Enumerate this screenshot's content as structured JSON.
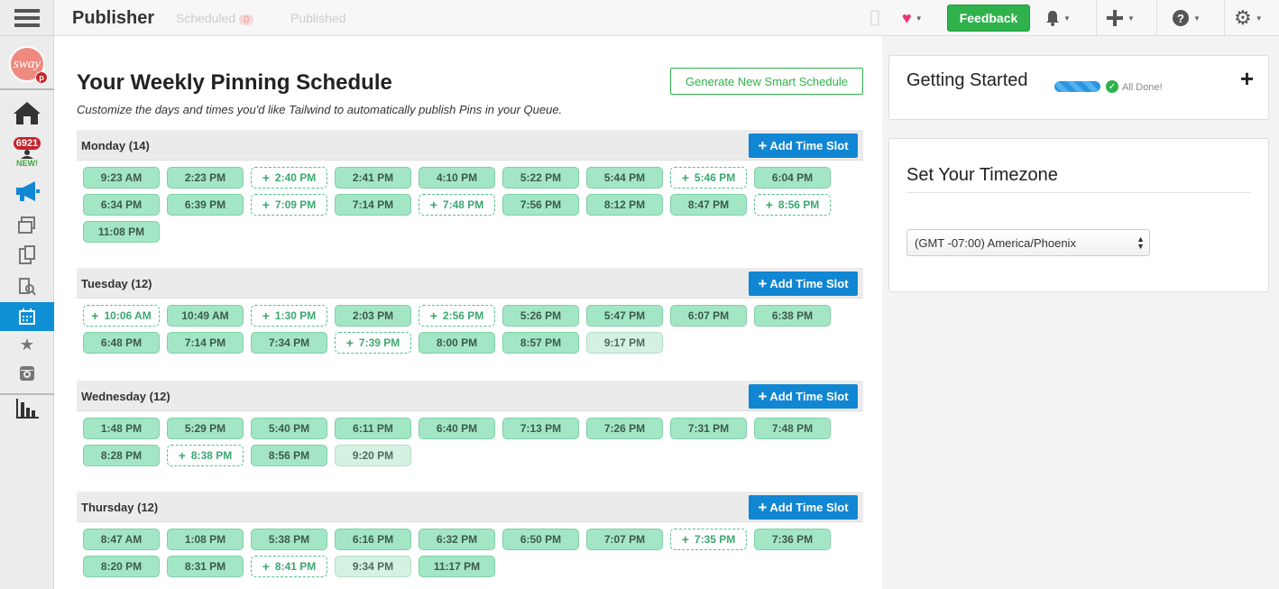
{
  "app": {
    "title": "Publisher",
    "ghost_tabs": [
      {
        "label": "Scheduled",
        "count": "0"
      },
      {
        "label": "Published"
      }
    ],
    "feedback_label": "Feedback"
  },
  "sidebar": {
    "avatar_text": "sway",
    "avatar_pin": "p",
    "badge_count": "6921",
    "new_label": "NEW!"
  },
  "main": {
    "title": "Your Weekly Pinning Schedule",
    "subtitle": "Customize the days and times you'd like Tailwind to automatically publish Pins in your Queue.",
    "generate_button": "Generate New Smart Schedule",
    "add_slot_label": "Add Time Slot",
    "days": [
      {
        "name": "Monday (14)",
        "slots": [
          {
            "time": "9:23 AM",
            "state": "filled"
          },
          {
            "time": "2:23 PM",
            "state": "filled"
          },
          {
            "time": "2:40 PM",
            "state": "empty"
          },
          {
            "time": "2:41 PM",
            "state": "filled"
          },
          {
            "time": "4:10 PM",
            "state": "filled"
          },
          {
            "time": "5:22 PM",
            "state": "filled"
          },
          {
            "time": "5:44 PM",
            "state": "filled"
          },
          {
            "time": "5:46 PM",
            "state": "empty"
          },
          {
            "time": "6:04 PM",
            "state": "filled"
          },
          {
            "time": "6:34 PM",
            "state": "filled"
          },
          {
            "time": "6:39 PM",
            "state": "filled"
          },
          {
            "time": "7:09 PM",
            "state": "empty"
          },
          {
            "time": "7:14 PM",
            "state": "filled"
          },
          {
            "time": "7:48 PM",
            "state": "empty"
          },
          {
            "time": "7:56 PM",
            "state": "filled"
          },
          {
            "time": "8:12 PM",
            "state": "filled"
          },
          {
            "time": "8:47 PM",
            "state": "filled"
          },
          {
            "time": "8:56 PM",
            "state": "empty"
          },
          {
            "time": "11:08 PM",
            "state": "filled"
          }
        ]
      },
      {
        "name": "Tuesday (12)",
        "slots": [
          {
            "time": "10:06 AM",
            "state": "empty"
          },
          {
            "time": "10:49 AM",
            "state": "filled"
          },
          {
            "time": "1:30 PM",
            "state": "empty"
          },
          {
            "time": "2:03 PM",
            "state": "filled"
          },
          {
            "time": "2:56 PM",
            "state": "empty"
          },
          {
            "time": "5:26 PM",
            "state": "filled"
          },
          {
            "time": "5:47 PM",
            "state": "filled"
          },
          {
            "time": "6:07 PM",
            "state": "filled"
          },
          {
            "time": "6:38 PM",
            "state": "filled"
          },
          {
            "time": "6:48 PM",
            "state": "filled"
          },
          {
            "time": "7:14 PM",
            "state": "filled"
          },
          {
            "time": "7:34 PM",
            "state": "filled"
          },
          {
            "time": "7:39 PM",
            "state": "empty"
          },
          {
            "time": "8:00 PM",
            "state": "filled"
          },
          {
            "time": "8:57 PM",
            "state": "filled"
          },
          {
            "time": "9:17 PM",
            "state": "pending"
          }
        ]
      },
      {
        "name": "Wednesday (12)",
        "slots": [
          {
            "time": "1:48 PM",
            "state": "filled"
          },
          {
            "time": "5:29 PM",
            "state": "filled"
          },
          {
            "time": "5:40 PM",
            "state": "filled"
          },
          {
            "time": "6:11 PM",
            "state": "filled"
          },
          {
            "time": "6:40 PM",
            "state": "filled"
          },
          {
            "time": "7:13 PM",
            "state": "filled"
          },
          {
            "time": "7:26 PM",
            "state": "filled"
          },
          {
            "time": "7:31 PM",
            "state": "filled"
          },
          {
            "time": "7:48 PM",
            "state": "filled"
          },
          {
            "time": "8:28 PM",
            "state": "filled"
          },
          {
            "time": "8:38 PM",
            "state": "empty"
          },
          {
            "time": "8:56 PM",
            "state": "filled"
          },
          {
            "time": "9:20 PM",
            "state": "pending"
          }
        ]
      },
      {
        "name": "Thursday (12)",
        "slots": [
          {
            "time": "8:47 AM",
            "state": "filled"
          },
          {
            "time": "1:08 PM",
            "state": "filled"
          },
          {
            "time": "5:38 PM",
            "state": "filled"
          },
          {
            "time": "6:16 PM",
            "state": "filled"
          },
          {
            "time": "6:32 PM",
            "state": "filled"
          },
          {
            "time": "6:50 PM",
            "state": "filled"
          },
          {
            "time": "7:07 PM",
            "state": "filled"
          },
          {
            "time": "7:35 PM",
            "state": "empty"
          },
          {
            "time": "7:36 PM",
            "state": "filled"
          },
          {
            "time": "8:20 PM",
            "state": "filled"
          },
          {
            "time": "8:31 PM",
            "state": "filled"
          },
          {
            "time": "8:41 PM",
            "state": "empty"
          },
          {
            "time": "9:34 PM",
            "state": "pending"
          },
          {
            "time": "11:17 PM",
            "state": "filled"
          }
        ]
      }
    ]
  },
  "getting_started": {
    "title": "Getting Started",
    "status": "All Done!",
    "progress": 1.0
  },
  "timezone": {
    "title": "Set Your Timezone",
    "selected": "(GMT -07:00) America/Phoenix"
  },
  "colors": {
    "accent_blue": "#1186d2",
    "feedback_green": "#2fb24c",
    "slot_filled": "#a3e6c5",
    "slot_empty_border": "#4fc089"
  },
  "icons": [
    "hamburger-icon",
    "home-icon",
    "megaphone-icon",
    "calendar-icon",
    "star-icon",
    "instagram-icon",
    "bar-chart-icon",
    "heart-icon",
    "bell-icon",
    "plus-icon",
    "help-icon",
    "gear-icon"
  ]
}
